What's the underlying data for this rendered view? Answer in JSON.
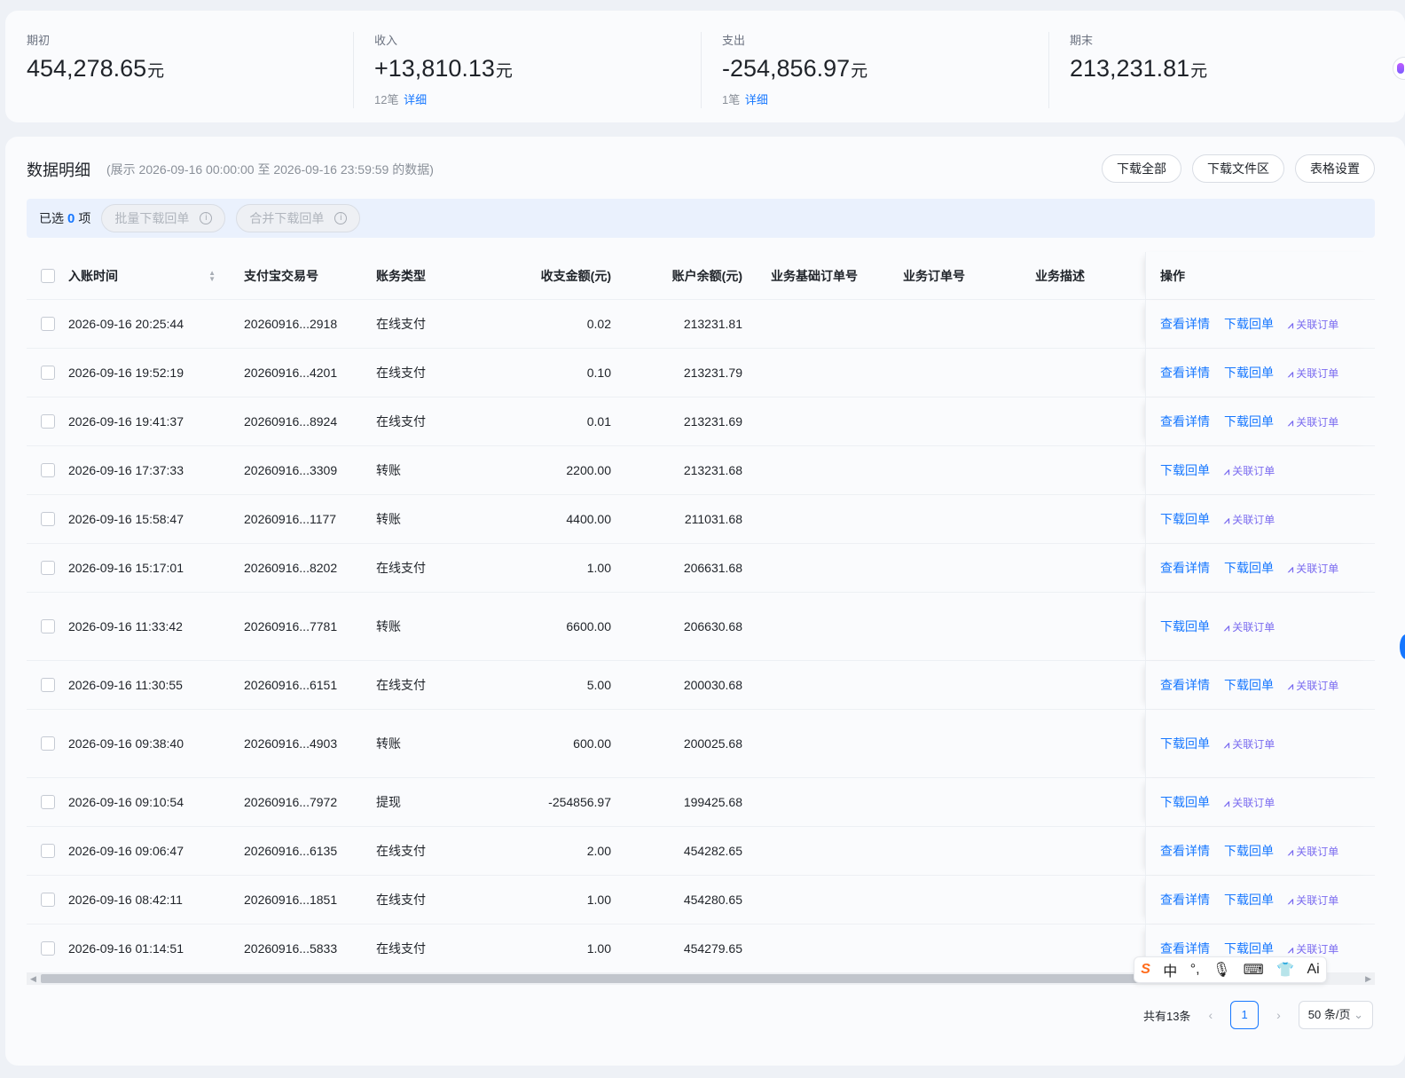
{
  "summary": [
    {
      "label": "期初",
      "value": "454,278.65",
      "unit": "元",
      "count": "",
      "link": ""
    },
    {
      "label": "收入",
      "value": "+13,810.13",
      "unit": "元",
      "count": "12笔",
      "link": "详细"
    },
    {
      "label": "支出",
      "value": "-254,856.97",
      "unit": "元",
      "count": "1笔",
      "link": "详细"
    },
    {
      "label": "期末",
      "value": "213,231.81",
      "unit": "元",
      "count": "",
      "link": ""
    }
  ],
  "panel": {
    "title": "数据明细",
    "range": "(展示 2026-09-16 00:00:00 至 2026-09-16 23:59:59 的数据)",
    "buttons": [
      "下载全部",
      "下载文件区",
      "表格设置"
    ]
  },
  "selection": {
    "prefix": "已选",
    "count": "0",
    "suffix": "项",
    "batch_download": "批量下载回单",
    "merge_download": "合并下载回单"
  },
  "table": {
    "columns": [
      "入账时间",
      "支付宝交易号",
      "账务类型",
      "收支金额(元)",
      "账户余额(元)",
      "业务基础订单号",
      "业务订单号",
      "业务描述",
      "操作"
    ],
    "ops": {
      "view": "查看详情",
      "download": "下载回单",
      "related": "关联订单",
      "related_icon": "ꟿ"
    },
    "rows": [
      {
        "time": "2026-09-16 20:25:44",
        "trade": "20260916...2918",
        "type": "在线支付",
        "amount": "0.02",
        "balance": "213231.81",
        "has_view": true
      },
      {
        "time": "2026-09-16 19:52:19",
        "trade": "20260916...4201",
        "type": "在线支付",
        "amount": "0.10",
        "balance": "213231.79",
        "has_view": true
      },
      {
        "time": "2026-09-16 19:41:37",
        "trade": "20260916...8924",
        "type": "在线支付",
        "amount": "0.01",
        "balance": "213231.69",
        "has_view": true
      },
      {
        "time": "2026-09-16 17:37:33",
        "trade": "20260916...3309",
        "type": "转账",
        "amount": "2200.00",
        "balance": "213231.68",
        "has_view": false
      },
      {
        "time": "2026-09-16 15:58:47",
        "trade": "20260916...1177",
        "type": "转账",
        "amount": "4400.00",
        "balance": "211031.68",
        "has_view": false
      },
      {
        "time": "2026-09-16 15:17:01",
        "trade": "20260916...8202",
        "type": "在线支付",
        "amount": "1.00",
        "balance": "206631.68",
        "has_view": true
      },
      {
        "time": "2026-09-16 11:33:42",
        "trade": "20260916...7781",
        "type": "转账",
        "amount": "6600.00",
        "balance": "206630.68",
        "has_view": false
      },
      {
        "time": "2026-09-16 11:30:55",
        "trade": "20260916...6151",
        "type": "在线支付",
        "amount": "5.00",
        "balance": "200030.68",
        "has_view": true
      },
      {
        "time": "2026-09-16 09:38:40",
        "trade": "20260916...4903",
        "type": "转账",
        "amount": "600.00",
        "balance": "200025.68",
        "has_view": false
      },
      {
        "time": "2026-09-16 09:10:54",
        "trade": "20260916...7972",
        "type": "提现",
        "amount": "-254856.97",
        "balance": "199425.68",
        "has_view": false
      },
      {
        "time": "2026-09-16 09:06:47",
        "trade": "20260916...6135",
        "type": "在线支付",
        "amount": "2.00",
        "balance": "454282.65",
        "has_view": true
      },
      {
        "time": "2026-09-16 08:42:11",
        "trade": "20260916...1851",
        "type": "在线支付",
        "amount": "1.00",
        "balance": "454280.65",
        "has_view": true
      },
      {
        "time": "2026-09-16 01:14:51",
        "trade": "20260916...5833",
        "type": "在线支付",
        "amount": "1.00",
        "balance": "454279.65",
        "has_view": true
      }
    ]
  },
  "pager": {
    "total": "共有13条",
    "page": "1",
    "size": "50 条/页",
    "prev": "‹",
    "next": "›"
  },
  "ime": [
    "中",
    "°,",
    "🎙",
    "⌨",
    "👕",
    "Ai"
  ],
  "colors": {
    "accent": "#1677ff",
    "related": "#7b6cf0",
    "selection_bg": "#eaf1fd"
  }
}
